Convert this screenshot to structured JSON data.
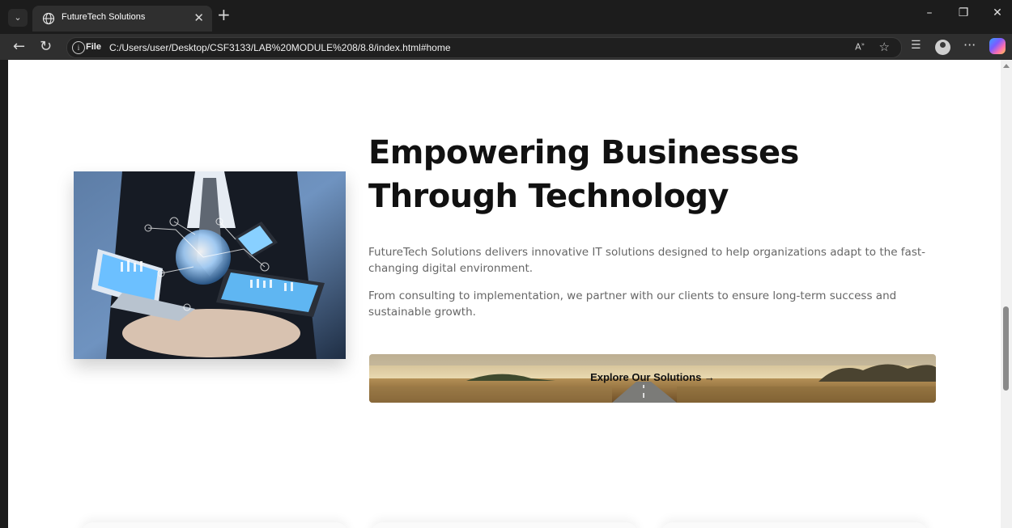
{
  "browser": {
    "tab_title": "FutureTech Solutions",
    "tab_close": "✕",
    "new_tab": "+",
    "address_prefix": "File",
    "url": "C:/Users/user/Desktop/CSF3133/LAB%20MODULE%208/8.8/index.html#home",
    "read_aloud": "A̶",
    "icons": [
      "tab-list-icon",
      "globe-icon",
      "back-icon",
      "refresh-icon",
      "info-icon",
      "read-aloud-icon",
      "favorite-star-icon",
      "collections-icon",
      "profile-icon",
      "more-icon",
      "copilot-icon",
      "minimize-icon",
      "restore-icon",
      "close-icon"
    ]
  },
  "hero": {
    "title": "Empowering Businesses Through Technology",
    "paragraph1": "FutureTech Solutions delivers innovative IT solutions designed to help organizations adapt to the fast-changing digital environment.",
    "paragraph2": "From consulting to implementation, we partner with our clients to ensure long-term success and sustainable growth.",
    "cta_label": "Explore Our Solutions →"
  },
  "colors": {
    "browser_frame": "#1c1c1c",
    "toolbar": "#2f2f2f",
    "page_bg": "#ffffff",
    "title_text": "#111111",
    "body_text": "#666666"
  }
}
